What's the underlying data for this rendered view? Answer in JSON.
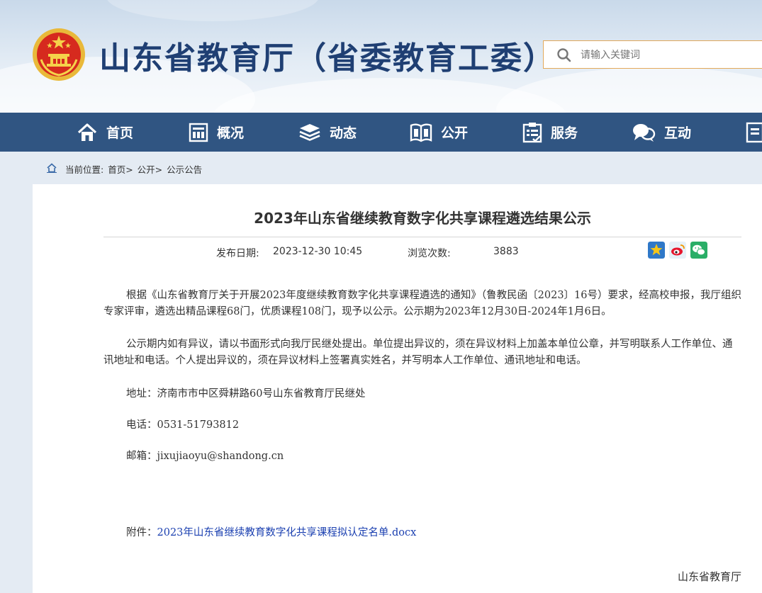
{
  "header": {
    "site_title": "山东省教育厅（省委教育工委）",
    "search_placeholder": "请输入关键词"
  },
  "nav": {
    "items": [
      {
        "label": "首页",
        "icon": "home-icon"
      },
      {
        "label": "概况",
        "icon": "building-icon"
      },
      {
        "label": "动态",
        "icon": "layers-icon"
      },
      {
        "label": "公开",
        "icon": "book-icon"
      },
      {
        "label": "服务",
        "icon": "clipboard-icon"
      },
      {
        "label": "互动",
        "icon": "chat-icon"
      }
    ]
  },
  "breadcrumb": {
    "prefix": "当前位置:",
    "items": [
      "首页>",
      "公开>",
      "公示公告"
    ]
  },
  "article": {
    "title": "2023年山东省继续教育数字化共享课程遴选结果公示",
    "date_label": "发布日期:",
    "date_value": "2023-12-30 10:45",
    "views_label": "浏览次数:",
    "views_value": "3883",
    "share_icons": [
      "star-share-icon",
      "weibo-icon",
      "wechat-icon"
    ],
    "paragraph1": "根据《山东省教育厅关于开展2023年度继续教育数字化共享课程遴选的通知》（鲁教民函〔2023〕16号）要求，经高校申报，我厅组织专家评审，遴选出精品课程68门，优质课程108门，现予以公示。公示期为2023年12月30日-2024年1月6日。",
    "paragraph2": "公示期内如有异议，请以书面形式向我厅民继处提出。单位提出异议的，须在异议材料上加盖本单位公章，并写明联系人工作单位、通讯地址和电话。个人提出异议的，须在异议材料上签署真实姓名，并写明本人工作单位、通讯地址和电话。",
    "address": "地址：济南市市中区舜耕路60号山东省教育厅民继处",
    "phone": "电话：0531-51793812",
    "email": "邮箱：jixujiaoyu@shandong.cn",
    "attachment_label": "附件：",
    "attachment_link": "2023年山东省继续教育数字化共享课程拟认定名单.docx",
    "signature": "山东省教育厅"
  },
  "colors": {
    "nav_bg": "#305582",
    "title_blue": "#1f3f73",
    "link_blue": "#1a3fb0",
    "search_border": "#e3a95a"
  }
}
